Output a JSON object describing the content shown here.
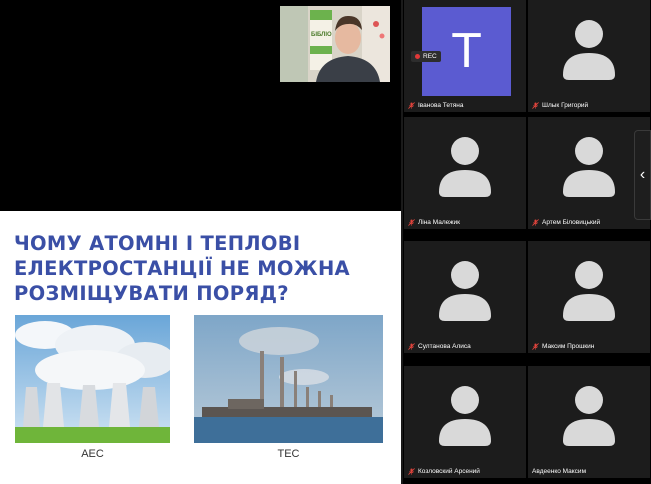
{
  "slide": {
    "title_lines": [
      "ЧОМУ АТОМНІ І ТЕПЛОВІ",
      "ЕЛЕКТРОСТАНЦІЇ НЕ МОЖНА",
      "РОЗМІЩУВАТИ ПОРЯД?"
    ],
    "captions": {
      "aes": "АЕС",
      "tes": "ТЕС"
    }
  },
  "presenter": {
    "banner_text": "БІБЛІО"
  },
  "recording": {
    "label": "REC"
  },
  "participants": [
    {
      "name": "Іванова Тетяна",
      "initial": "T",
      "muted": true
    },
    {
      "name": "Шлык Григорий",
      "muted": true
    },
    {
      "name": "Ліна Малежик",
      "muted": true
    },
    {
      "name": "Артем Біловицький",
      "muted": true
    },
    {
      "name": "Султанова Алиса",
      "muted": true
    },
    {
      "name": "Максим Прошкин",
      "muted": true
    },
    {
      "name": "Козловский Арсений",
      "muted": true
    },
    {
      "name": "Авдеенко Максим",
      "muted": true
    }
  ],
  "icons": {
    "mic": "mic-muted-icon",
    "collapse": "chevron-left-icon",
    "avatar": "person-avatar-icon"
  },
  "colors": {
    "slide_title": "#3a4fa6",
    "avatar_letter_bg": "#5b5bd1",
    "muted_mic": "#e0443c"
  }
}
